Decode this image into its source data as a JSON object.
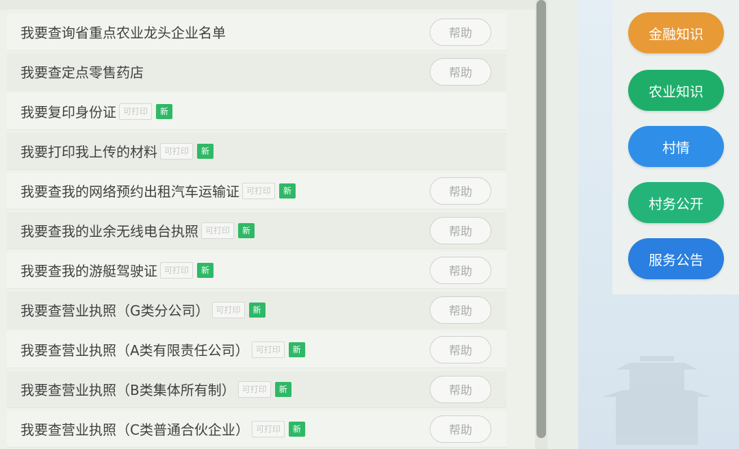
{
  "list": {
    "printable_tag": "可打印",
    "new_tag": "新",
    "help_label": "帮助",
    "items": [
      {
        "label": "我要查询省重点农业龙头企业名单",
        "printable": false,
        "new": false,
        "help": true
      },
      {
        "label": "我要查定点零售药店",
        "printable": false,
        "new": false,
        "help": true
      },
      {
        "label": "我要复印身份证",
        "printable": true,
        "new": true,
        "help": false
      },
      {
        "label": "我要打印我上传的材料",
        "printable": true,
        "new": true,
        "help": false
      },
      {
        "label": "我要查我的网络预约出租汽车运输证",
        "printable": true,
        "new": true,
        "help": true
      },
      {
        "label": "我要查我的业余无线电台执照",
        "printable": true,
        "new": true,
        "help": true
      },
      {
        "label": "我要查我的游艇驾驶证",
        "printable": true,
        "new": true,
        "help": true
      },
      {
        "label": "我要查营业执照（G类分公司）",
        "printable": true,
        "new": true,
        "help": true
      },
      {
        "label": "我要查营业执照（A类有限责任公司）",
        "printable": true,
        "new": true,
        "help": true
      },
      {
        "label": "我要查营业执照（B类集体所有制）",
        "printable": true,
        "new": true,
        "help": true
      },
      {
        "label": "我要查营业执照（C类普通合伙企业）",
        "printable": true,
        "new": true,
        "help": true
      }
    ]
  },
  "sidebar": {
    "buttons": [
      {
        "label": "金融知识",
        "color": "#e89a36"
      },
      {
        "label": "农业知识",
        "color": "#1fae6a"
      },
      {
        "label": "村情",
        "color": "#2f8fe8"
      },
      {
        "label": "村务公开",
        "color": "#24b47a"
      },
      {
        "label": "服务公告",
        "color": "#2a7fe0"
      }
    ]
  },
  "colors": {
    "new_badge": "#2fb866",
    "scrollbar": "#9aa09a"
  },
  "icons": {
    "landmark": "pagoda-landmark-icon"
  }
}
